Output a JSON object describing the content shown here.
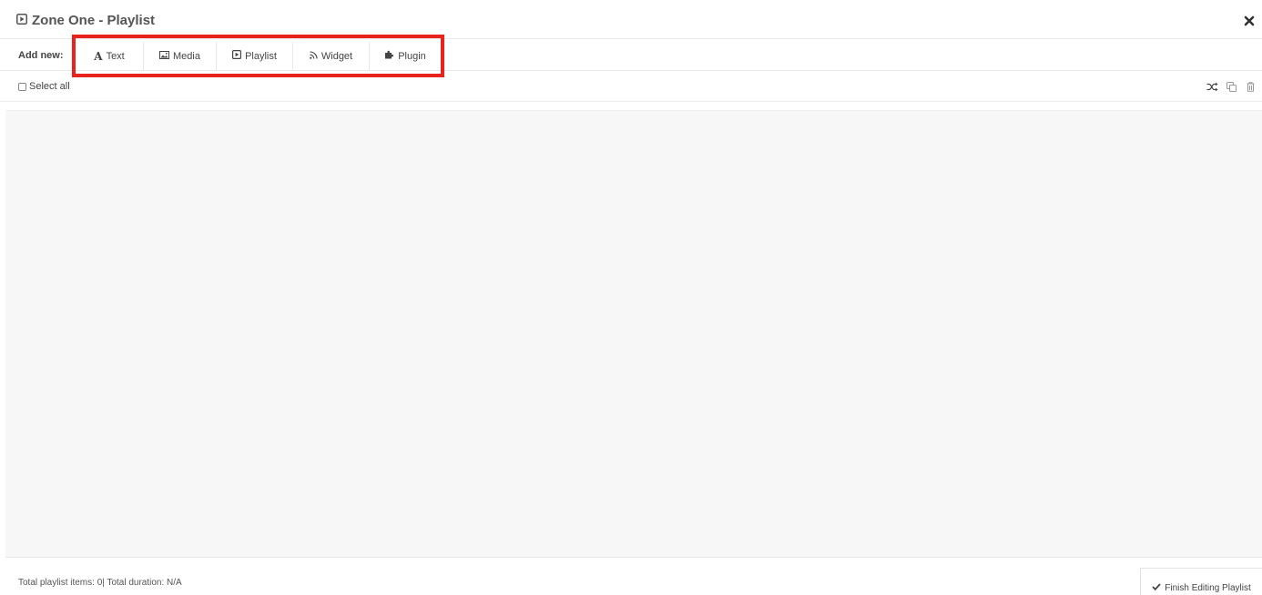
{
  "header": {
    "title": "Zone One - Playlist",
    "title_icon": "play-square-icon",
    "close_icon": "close-icon"
  },
  "add_new": {
    "label": "Add new:",
    "buttons": [
      {
        "label": "Text",
        "icon": "font-icon"
      },
      {
        "label": "Media",
        "icon": "image-icon"
      },
      {
        "label": "Playlist",
        "icon": "play-square-icon"
      },
      {
        "label": "Widget",
        "icon": "rss-icon"
      },
      {
        "label": "Plugin",
        "icon": "puzzle-icon"
      }
    ]
  },
  "selection": {
    "select_all_label": "Select all",
    "tools": [
      "shuffle-icon",
      "copy-icon",
      "trash-icon"
    ]
  },
  "footer": {
    "summary": "Total playlist items: 0| Total duration: N/A",
    "finish_label": "Finish Editing Playlist",
    "finish_icon": "check-icon"
  },
  "colors": {
    "highlight": "#e8231e",
    "list_background": "#f7f7f7"
  }
}
